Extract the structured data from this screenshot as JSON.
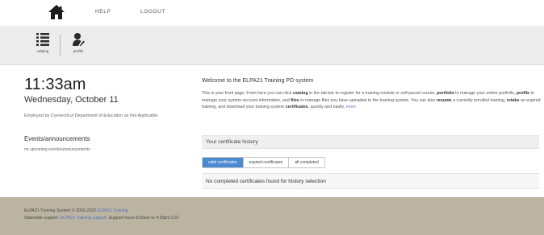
{
  "nav": {
    "help": "HELP",
    "logout": "LOGOUT"
  },
  "toolbar": {
    "catalog": "catalog",
    "profile": "profile"
  },
  "left": {
    "time": "11:33am",
    "date": "Wednesday, October 11",
    "employer": "Employed by Connecticut Department of Education as Not Applicable",
    "events_title": "Events/announcements",
    "events_empty": "no upcoming events/announcements"
  },
  "welcome": {
    "title": "Welcome to the ELPA21 Training PD system",
    "p1": "This is your front page. From here you can click ",
    "w_catalog": "catalog",
    "p2": " in the tab bar to register for a training module or self-paced course, ",
    "w_portfolio": "portfolio",
    "p3": " to manage your online portfolio, ",
    "w_profile": "profile",
    "p4": " to manage your system account information, and ",
    "w_files": "files",
    "p5": " to manage files you have uploaded to the training system. You can also ",
    "w_resume": "resume",
    "p6": " a currently enrolled training, ",
    "w_retake": "retake",
    "p7": " an expired training, and download your training system ",
    "w_certificates": "certificates",
    "p8": ", quickly and easily. ",
    "more": "more"
  },
  "certificates": {
    "header": "Your certificate history",
    "tabs": [
      {
        "label": "valid certificates",
        "active": true
      },
      {
        "label": "expired certificates",
        "active": false
      },
      {
        "label": "all completed",
        "active": false
      }
    ],
    "empty_message": "No completed certificates found for history selection"
  },
  "footer": {
    "line1_text": "ELPA21 Training System © 2002-2023 ",
    "line1_link": "ELPA21 Training",
    "line2_prefix": "Statewide support: ",
    "line2_link": "ELPA21 Training support",
    "line2_suffix": ". Support hours 8:00am to 4:30pm CST"
  },
  "colors": {
    "active_tab": "#4a8ad1",
    "footer_bg": "#bcb4a2",
    "link": "#4f73c0"
  }
}
